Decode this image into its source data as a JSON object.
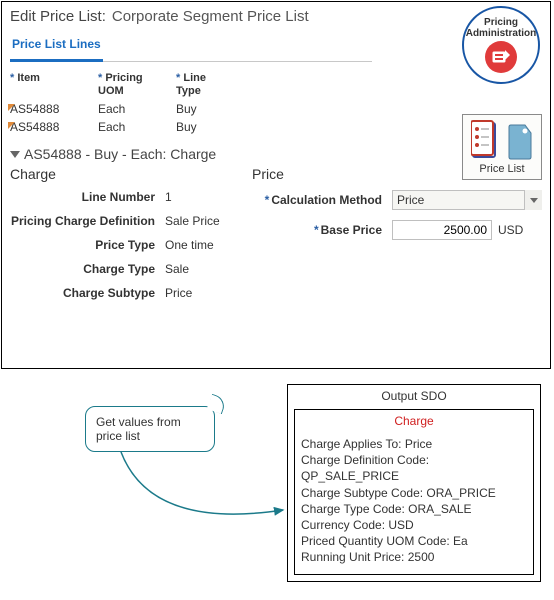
{
  "header": {
    "edit_label": "Edit Price List:",
    "name": "Corporate Segment Price List"
  },
  "tabs": {
    "lines": "Price List Lines"
  },
  "columns": {
    "item": "Item",
    "uom_l1": "Pricing",
    "uom_l2": "UOM",
    "type_l1": "Line",
    "type_l2": "Type"
  },
  "rows": [
    {
      "item": "AS54888",
      "uom": "Each",
      "type": "Buy"
    },
    {
      "item": "AS54888",
      "uom": "Each",
      "type": "Buy"
    }
  ],
  "section": {
    "title": "AS54888 - Buy - Each: Charge"
  },
  "left_head": "Charge",
  "right_head": "Price",
  "left": {
    "line_number_label": "Line Number",
    "line_number": "1",
    "pcd_label": "Pricing Charge Definition",
    "pcd": "Sale Price",
    "ptype_label": "Price Type",
    "ptype": "One time",
    "ctype_label": "Charge Type",
    "ctype": "Sale",
    "csub_label": "Charge Subtype",
    "csub": "Price"
  },
  "right": {
    "calc_label": "Calculation Method",
    "calc_value": "Price",
    "base_label": "Base Price",
    "base_value": "2500.00",
    "currency": "USD"
  },
  "badges": {
    "pricing_l1": "Pricing",
    "pricing_l2": "Administration",
    "pricelist": "Price List"
  },
  "callout": "Get values from price list",
  "output": {
    "title": "Output SDO",
    "charge_title": "Charge",
    "lines": [
      "Charge Applies To: Price",
      "Charge Definition Code: QP_SALE_PRICE",
      "Charge Subtype Code: ORA_PRICE",
      "Charge Type Code: ORA_SALE",
      "Currency Code: USD",
      "Priced Quantity UOM Code: Ea",
      "Running Unit Price: 2500"
    ]
  },
  "chart_data": {
    "type": "table",
    "title": "Output SDO — Charge",
    "fields": [
      {
        "name": "Charge Applies To",
        "value": "Price"
      },
      {
        "name": "Charge Definition Code",
        "value": "QP_SALE_PRICE"
      },
      {
        "name": "Charge Subtype Code",
        "value": "ORA_PRICE"
      },
      {
        "name": "Charge Type Code",
        "value": "ORA_SALE"
      },
      {
        "name": "Currency Code",
        "value": "USD"
      },
      {
        "name": "Priced Quantity UOM Code",
        "value": "Ea"
      },
      {
        "name": "Running Unit Price",
        "value": 2500
      }
    ]
  }
}
